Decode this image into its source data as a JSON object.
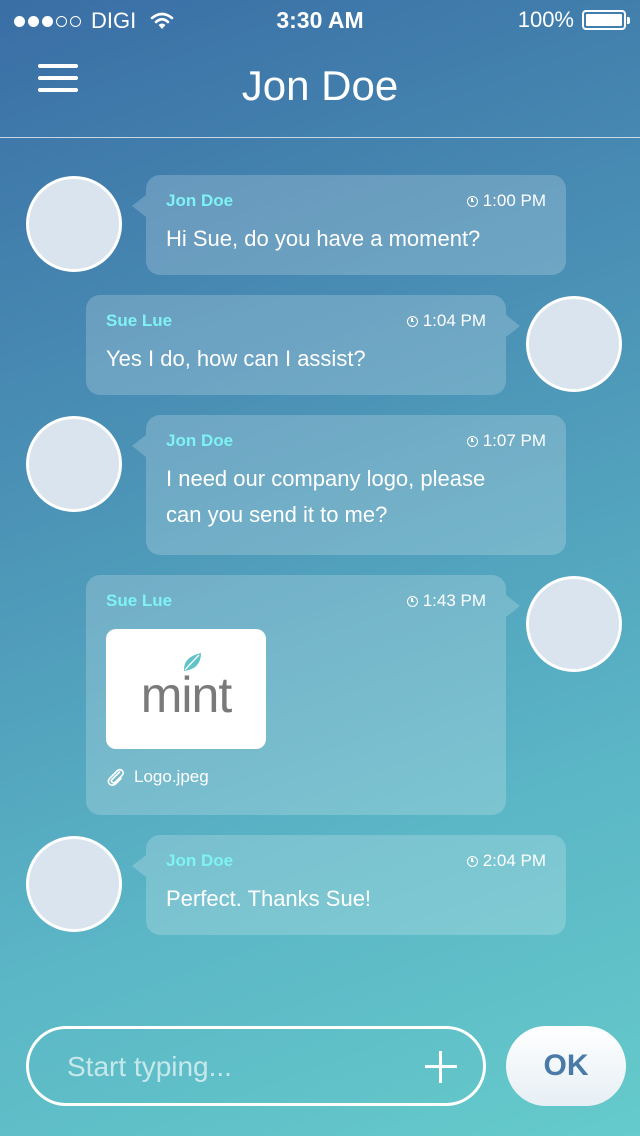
{
  "status_bar": {
    "carrier": "DIGI",
    "time": "3:30 AM",
    "battery": "100%",
    "battery_level": 1.0,
    "signal_strength": 3,
    "signal_max": 5
  },
  "nav": {
    "title": "Jon Doe",
    "menu_icon": "hamburger-icon"
  },
  "messages": [
    {
      "sender": "Jon Doe",
      "time": "1:00 PM",
      "text": "Hi Sue, do you have a moment?",
      "side": "left"
    },
    {
      "sender": "Sue Lue",
      "time": "1:04 PM",
      "text": "Yes I do, how can I assist?",
      "side": "right"
    },
    {
      "sender": "Jon Doe",
      "time": "1:07 PM",
      "text_lines": [
        "I need our company logo, please",
        "can you send it to me?"
      ],
      "side": "left"
    },
    {
      "sender": "Sue Lue",
      "time": "1:43 PM",
      "attachment": {
        "logo_text": "mint",
        "filename": "Logo.jpeg"
      },
      "side": "right"
    },
    {
      "sender": "Jon Doe",
      "time": "2:04 PM",
      "text": "Perfect. Thanks Sue!",
      "side": "left"
    }
  ],
  "composer": {
    "placeholder": "Start typing...",
    "ok_label": "OK"
  },
  "colors": {
    "sender_name": "#7ff2f4",
    "avatar_fill": "#d9e4ee",
    "ok_text": "#4a7ba8",
    "background_top": "#3a6ea5",
    "background_bottom": "#65cbcb"
  }
}
